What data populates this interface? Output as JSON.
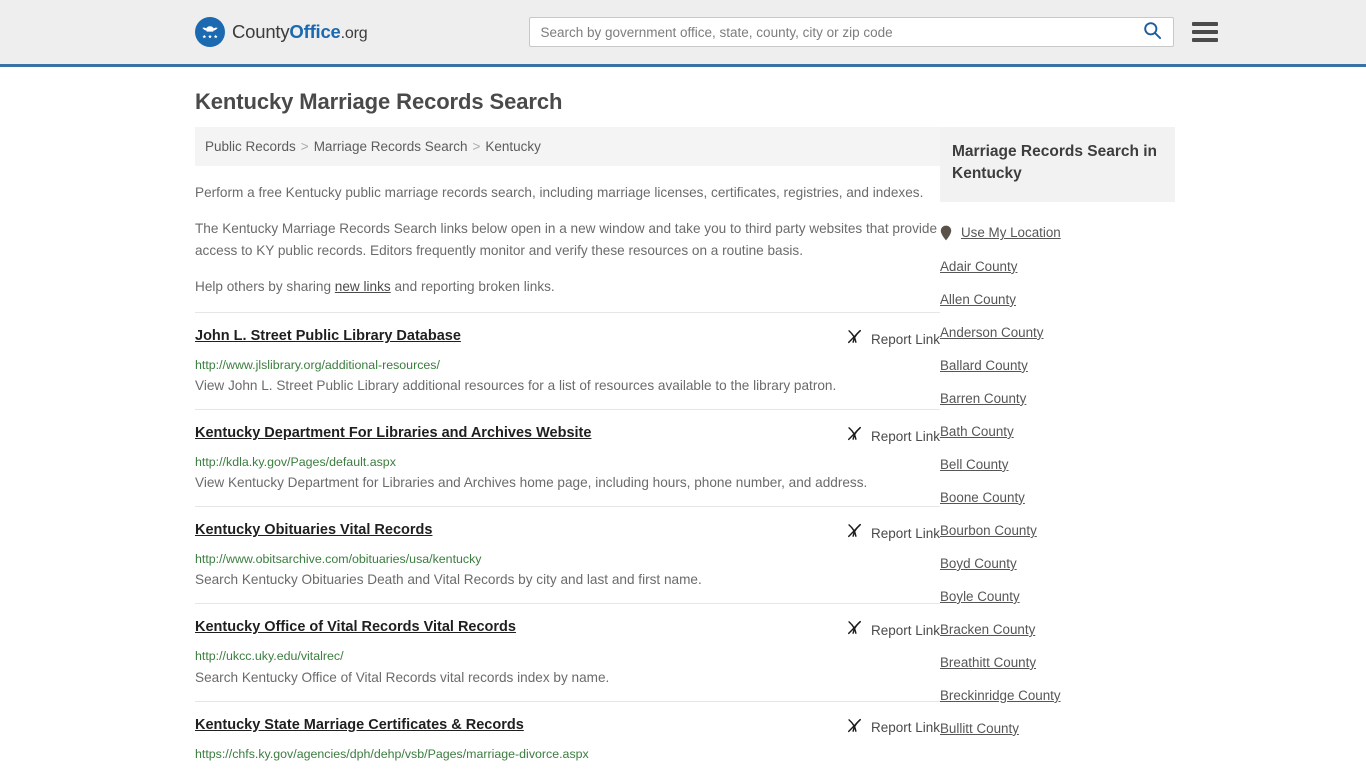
{
  "header": {
    "brand": {
      "part1": "County",
      "part2": "Office",
      "part3": ".org"
    },
    "search": {
      "placeholder": "Search by government office, state, county, city or zip code",
      "value": "",
      "button_label": "Search"
    },
    "menu_label": "Menu",
    "accent_color": "#3a72a8",
    "brand_color": "#1b69b0"
  },
  "page_title": "Kentucky Marriage Records Search",
  "breadcrumb": {
    "items": [
      "Public Records",
      "Marriage Records Search",
      "Kentucky"
    ],
    "separator": ">"
  },
  "intro": {
    "p1": "Perform a free Kentucky public marriage records search, including marriage licenses, certificates, registries, and indexes.",
    "p2": "The Kentucky Marriage Records Search links below open in a new window and take you to third party websites that provide access to KY public records. Editors frequently monitor and verify these resources on a routine basis.",
    "p3_before": "Help others by sharing ",
    "p3_link": "new links",
    "p3_after": " and reporting broken links."
  },
  "report_link_label": "Report Link",
  "report_link_icon": "broken-link-icon",
  "results": [
    {
      "title": "John L. Street Public Library Database",
      "url": "http://www.jlslibrary.org/additional-resources/",
      "description": "View John L. Street Public Library additional resources for a list of resources available to the library patron."
    },
    {
      "title": "Kentucky Department For Libraries and Archives Website",
      "url": "http://kdla.ky.gov/Pages/default.aspx",
      "description": "View Kentucky Department for Libraries and Archives home page, including hours, phone number, and address."
    },
    {
      "title": "Kentucky Obituaries Vital Records",
      "url": "http://www.obitsarchive.com/obituaries/usa/kentucky",
      "description": "Search Kentucky Obituaries Death and Vital Records by city and last and first name."
    },
    {
      "title": "Kentucky Office of Vital Records Vital Records",
      "url": "http://ukcc.uky.edu/vitalrec/",
      "description": "Search Kentucky Office of Vital Records vital records index by name."
    },
    {
      "title": "Kentucky State Marriage Certificates & Records",
      "url": "https://chfs.ky.gov/agencies/dph/dehp/vsb/Pages/marriage-divorce.aspx",
      "description": ""
    }
  ],
  "sidebar": {
    "title": "Marriage Records Search in Kentucky",
    "use_my_location": "Use My Location",
    "location_icon": "map-pin-icon",
    "counties": [
      "Adair County",
      "Allen County",
      "Anderson County",
      "Ballard County",
      "Barren County",
      "Bath County",
      "Bell County",
      "Boone County",
      "Bourbon County",
      "Boyd County",
      "Boyle County",
      "Bracken County",
      "Breathitt County",
      "Breckinridge County",
      "Bullitt County"
    ]
  },
  "colors": {
    "url_green": "#3b7d3f",
    "header_bg": "#eeeeee",
    "breadcrumb_bg": "#f4f4f4",
    "sidebar_head_bg": "#f2f2f2"
  }
}
